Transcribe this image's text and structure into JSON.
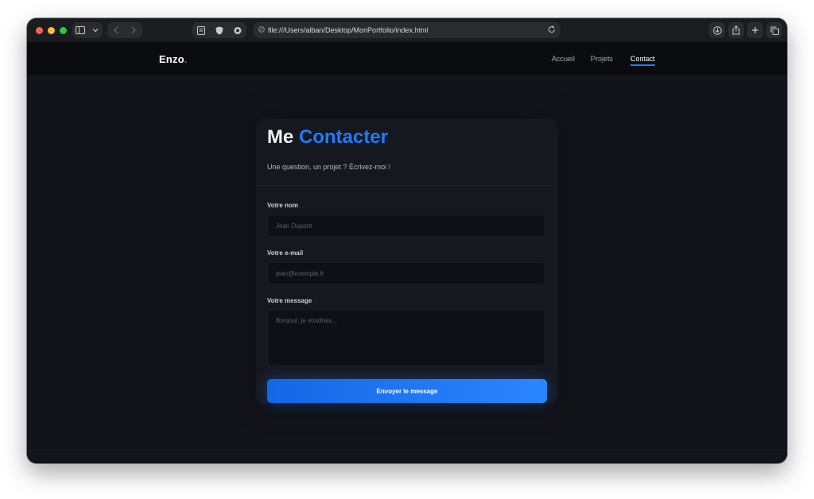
{
  "browser": {
    "url": "file:///Users/alban/Desktop/MonPortfolio/index.html",
    "icons": {
      "sidebar": "sidebar-icon",
      "back": "chevron-left-icon",
      "forward": "chevron-right-icon",
      "reload": "reload-icon",
      "download": "download-icon",
      "share": "share-icon",
      "new_tab": "plus-icon",
      "tabs": "tabs-icon"
    }
  },
  "site": {
    "brand": "Enzo",
    "brand_dot": ".",
    "nav": [
      {
        "label": "Accueil"
      },
      {
        "label": "Projets"
      },
      {
        "label": "Contact",
        "active": true
      }
    ]
  },
  "contact": {
    "title_1": "Me",
    "title_2": "Contacter",
    "subtitle": "Une question, un projet ? Écrivez-moi !",
    "name_label": "Votre nom",
    "name_placeholder": "Jean Dupont",
    "email_label": "Votre e-mail",
    "email_placeholder": "jean@exemple.fr",
    "message_label": "Votre message",
    "message_placeholder": "Bonjour, je voudrais...",
    "submit_label": "Envoyer le message"
  },
  "colors": {
    "accent": "#1f7bff",
    "background": "#12141a",
    "card": "#161820"
  }
}
